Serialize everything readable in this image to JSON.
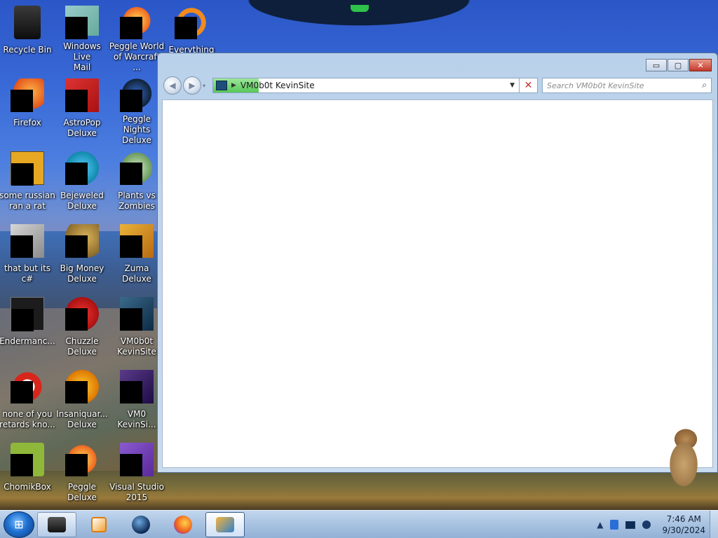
{
  "desktop": {
    "icons": [
      {
        "label": "Recycle Bin"
      },
      {
        "label": "Windows Live\nMail"
      },
      {
        "label": "Peggle World\nof Warcraft ..."
      },
      {
        "label": "Everything"
      },
      {
        "label": "Firefox"
      },
      {
        "label": "AstroPop\nDeluxe"
      },
      {
        "label": "Peggle Nights\nDeluxe"
      },
      {
        "label": "some russian\nran a rat"
      },
      {
        "label": "Bejeweled\nDeluxe"
      },
      {
        "label": "Plants vs\nZombies"
      },
      {
        "label": "that but its c#"
      },
      {
        "label": "Big Money\nDeluxe"
      },
      {
        "label": "Zuma Deluxe"
      },
      {
        "label": "Endermanc..."
      },
      {
        "label": "Chuzzle\nDeluxe"
      },
      {
        "label": "VM0b0t\nKevinSite"
      },
      {
        "label": "none of you\nretards kno..."
      },
      {
        "label": "Insaniquar...\nDeluxe"
      },
      {
        "label": "VM0\nKevinSi..."
      },
      {
        "label": "ChomikBox"
      },
      {
        "label": "Peggle Deluxe"
      },
      {
        "label": "Visual Studio\n2015"
      }
    ]
  },
  "window": {
    "address": "VM0b0t KevinSite",
    "address_progress": 0.15,
    "search_placeholder": "Search VM0b0t KevinSite",
    "minimize_glyph": "▭",
    "maximize_glyph": "▢",
    "close_glyph": "✕",
    "stop_glyph": "✕",
    "search_icon": "search-icon"
  },
  "taskbar": {
    "start_icon": "windows-logo-icon",
    "pinned": [
      {
        "name": "explorer-icon"
      },
      {
        "name": "media-player-icon"
      },
      {
        "name": "globe-icon"
      },
      {
        "name": "firefox-icon"
      },
      {
        "name": "explorer-window-icon"
      }
    ],
    "tray": {
      "show_hidden": "▲",
      "time": "7:46 AM",
      "date": "9/30/2024"
    }
  }
}
